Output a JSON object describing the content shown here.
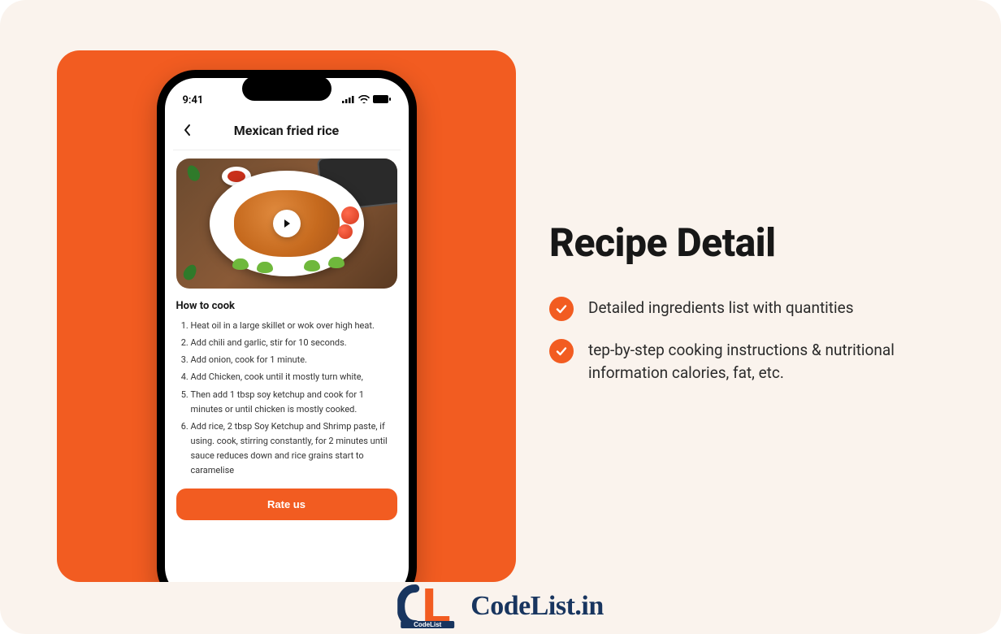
{
  "phone": {
    "status_time": "9:41",
    "app_title": "Mexican fried rice",
    "section_title": "How to cook",
    "steps": [
      "Heat oil in a large skillet or wok over high heat.",
      "Add chili and garlic, stir for 10 seconds.",
      "Add onion, cook for 1 minute.",
      "Add Chicken, cook until it mostly turn white,",
      " Then add 1 tbsp soy ketchup and cook for 1 minutes or until chicken is mostly cooked.",
      "Add rice, 2 tbsp Soy Ketchup and Shrimp paste, if using. cook, stirring constantly, for 2 minutes until sauce reduces down and rice grains start to caramelise"
    ],
    "rate_label": "Rate us"
  },
  "right": {
    "headline": "Recipe Detail",
    "features": [
      "Detailed ingredients list with quantities",
      "tep-by-step cooking instructions & nutritional information calories, fat, etc."
    ]
  },
  "brand": {
    "label_small": "CodeList",
    "text": "CodeList.in"
  }
}
